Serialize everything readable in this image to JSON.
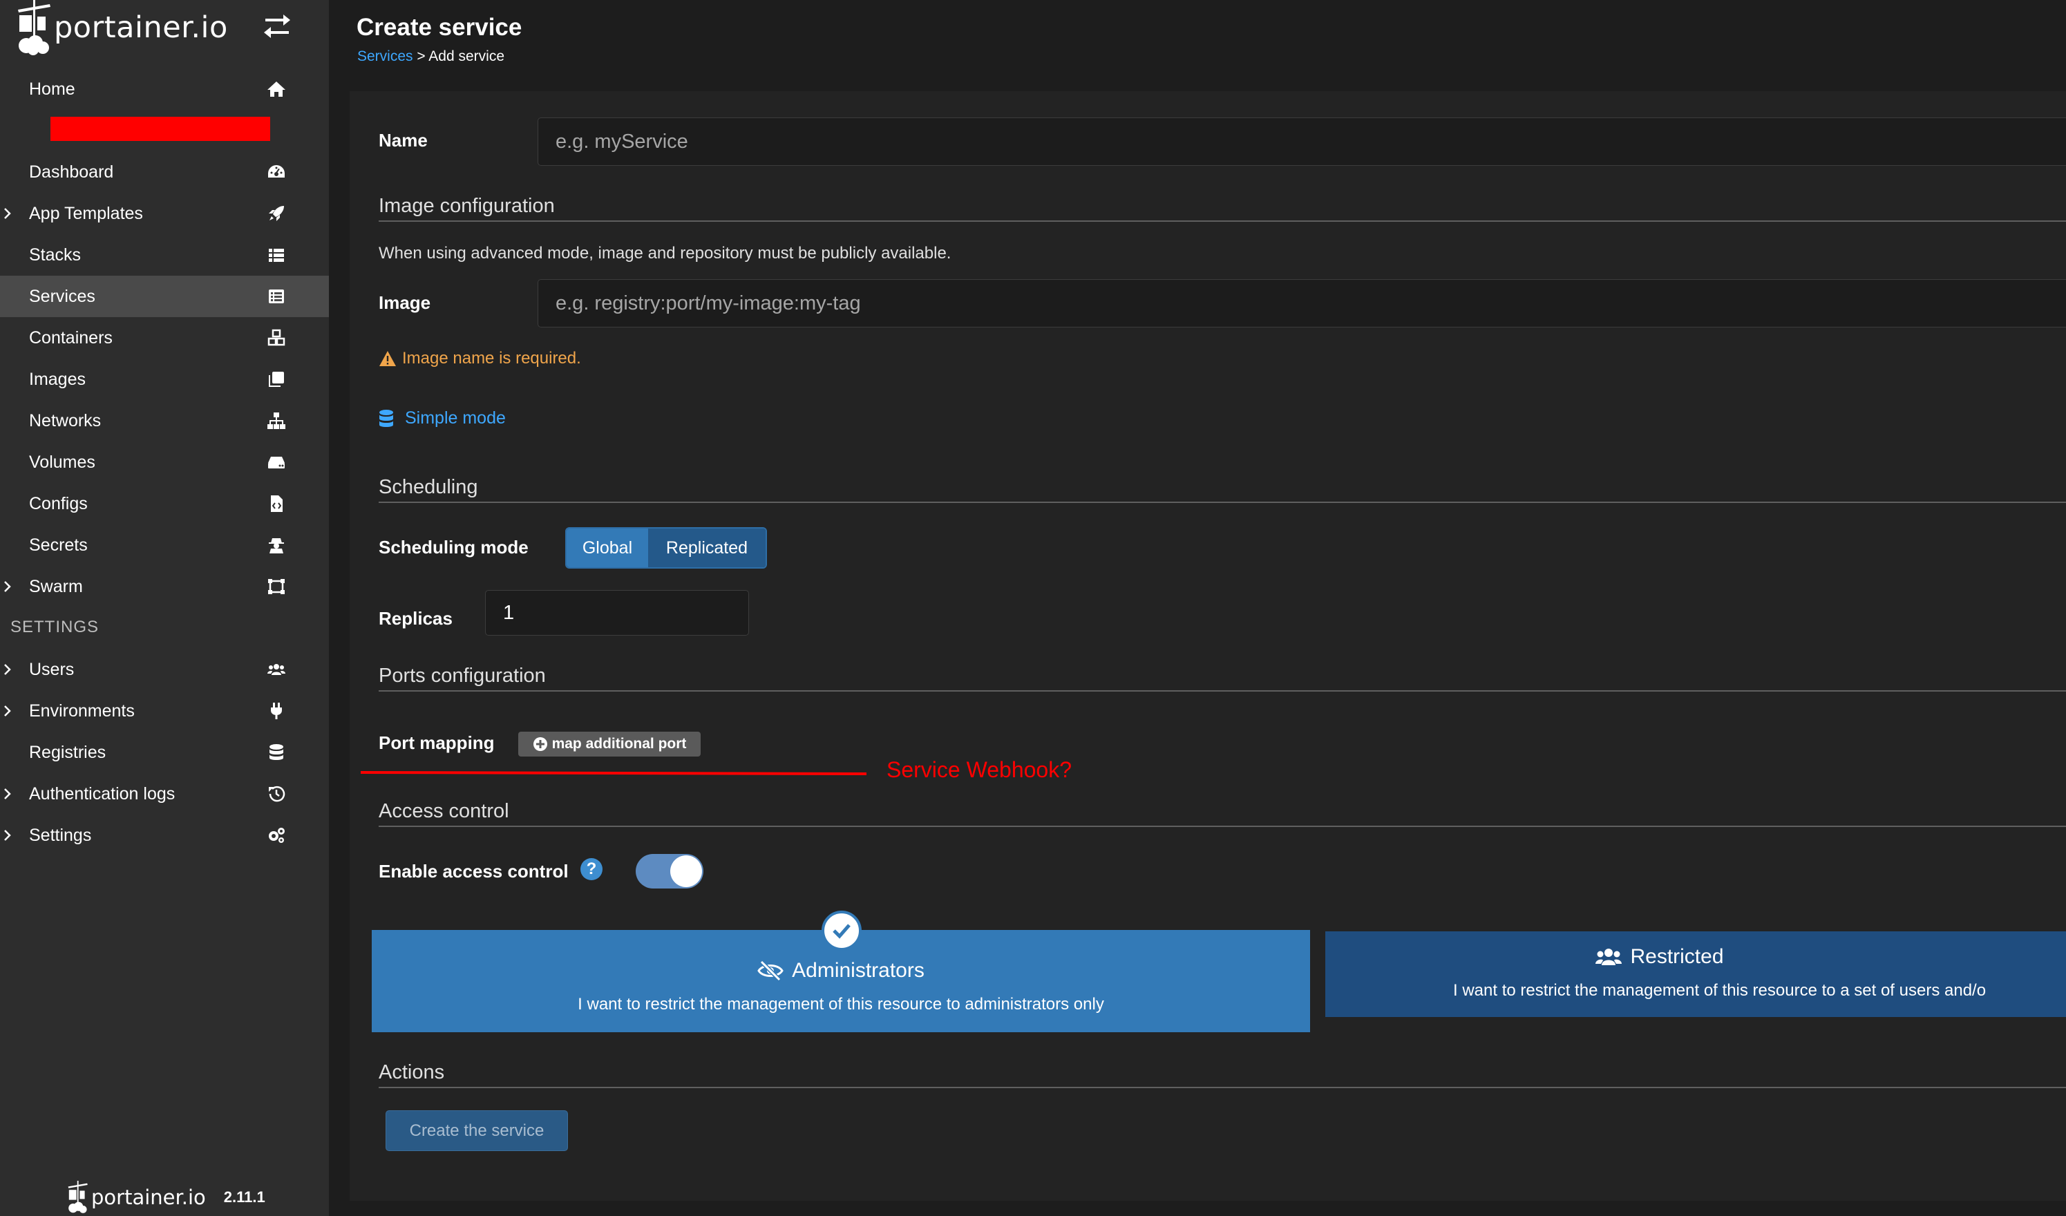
{
  "brand": {
    "name": "portainer.io"
  },
  "sidebar": {
    "items": [
      {
        "label": "Home",
        "icon": "home-icon"
      },
      {
        "label": "Dashboard",
        "icon": "dashboard-icon"
      },
      {
        "label": "App Templates",
        "icon": "rocket-icon"
      },
      {
        "label": "Stacks",
        "icon": "list-icon"
      },
      {
        "label": "Services",
        "icon": "services-icon"
      },
      {
        "label": "Containers",
        "icon": "containers-icon"
      },
      {
        "label": "Images",
        "icon": "images-icon"
      },
      {
        "label": "Networks",
        "icon": "sitemap-icon"
      },
      {
        "label": "Volumes",
        "icon": "hdd-icon"
      },
      {
        "label": "Configs",
        "icon": "file-code-icon"
      },
      {
        "label": "Secrets",
        "icon": "user-secret-icon"
      },
      {
        "label": "Swarm",
        "icon": "object-group-icon"
      }
    ],
    "settings_heading": "SETTINGS",
    "settings_items": [
      {
        "label": "Users",
        "icon": "users-icon"
      },
      {
        "label": "Environments",
        "icon": "plug-icon"
      },
      {
        "label": "Registries",
        "icon": "database-icon"
      },
      {
        "label": "Authentication logs",
        "icon": "history-icon"
      },
      {
        "label": "Settings",
        "icon": "cogs-icon"
      }
    ],
    "footer": {
      "brand": "portainer.io",
      "version": "2.11.1"
    }
  },
  "header": {
    "title": "Create service",
    "breadcrumb_link": "Services",
    "breadcrumb_rest": " > Add service"
  },
  "form": {
    "name_label": "Name",
    "name_placeholder": "e.g. myService",
    "image_section": "Image configuration",
    "image_help": "When using advanced mode, image and repository must be publicly available.",
    "image_label": "Image",
    "image_placeholder": "e.g. registry:port/my-image:my-tag",
    "image_warning": "Image name is required.",
    "simple_mode": "Simple mode",
    "scheduling_section": "Scheduling",
    "scheduling_mode_label": "Scheduling mode",
    "scheduling_options": [
      "Global",
      "Replicated"
    ],
    "replicas_label": "Replicas",
    "replicas_value": "1",
    "ports_section": "Ports configuration",
    "port_mapping_label": "Port mapping",
    "map_port_button": "map additional port",
    "annotation": "Service Webhook?",
    "access_section": "Access control",
    "enable_access_label": "Enable access control",
    "help_icon_text": "?",
    "access_enabled": true,
    "admin_box": {
      "title": "Administrators",
      "desc": "I want to restrict the management of this resource to administrators only"
    },
    "restricted_box": {
      "title": "Restricted",
      "desc": "I want to restrict the management of this resource to a set of users and/o"
    },
    "actions_section": "Actions",
    "create_button": "Create the service"
  },
  "colors": {
    "accent": "#337ab7",
    "link": "#3ea8ff",
    "warning": "#f0a54b",
    "annotation": "#ff0000",
    "sidebar_bg": "#2d2d2d",
    "panel_bg": "#232323"
  }
}
